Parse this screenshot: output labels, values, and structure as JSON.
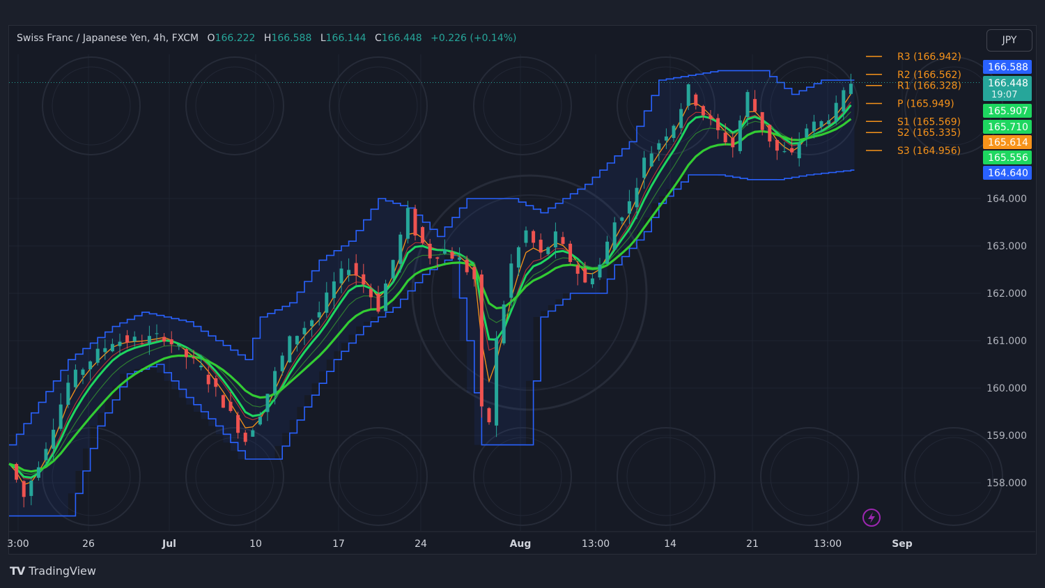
{
  "header": {
    "symbol": "Swiss Franc / Japanese Yen, 4h, FXCM",
    "open_label": "O",
    "open": "166.222",
    "high_label": "H",
    "high": "166.588",
    "low_label": "L",
    "low": "166.144",
    "close_label": "C",
    "close": "166.448",
    "change": "+0.226 (+0.14%)"
  },
  "currency_button": "JPY",
  "brand": {
    "name": "TradingView"
  },
  "colors": {
    "background": "#161a25",
    "up": "#26a69a",
    "down": "#ef5350",
    "channel": "#2962ff",
    "ema_fast": "#1ed760",
    "ema_slow": "#33cc33",
    "orange": "#f7931a",
    "red_line": "#e53935"
  },
  "chart_data": {
    "type": "candlestick",
    "timeframe": "4h",
    "y_ticks": [
      "164.000",
      "163.000",
      "162.000",
      "161.000",
      "160.000",
      "159.000",
      "158.000"
    ],
    "x_ticks": [
      {
        "label": "3:00",
        "bold": false
      },
      {
        "label": "26",
        "bold": false
      },
      {
        "label": "Jul",
        "bold": true
      },
      {
        "label": "10",
        "bold": false
      },
      {
        "label": "17",
        "bold": false
      },
      {
        "label": "24",
        "bold": false
      },
      {
        "label": "Aug",
        "bold": true
      },
      {
        "label": "13:00",
        "bold": false
      },
      {
        "label": "14",
        "bold": false
      },
      {
        "label": "21",
        "bold": false
      },
      {
        "label": "13:00",
        "bold": false
      },
      {
        "label": "Sep",
        "bold": true
      }
    ],
    "price_path": [
      [
        0,
        158.4
      ],
      [
        2,
        157.7
      ],
      [
        5,
        158.8
      ],
      [
        8,
        160.1
      ],
      [
        11,
        160.6
      ],
      [
        14,
        161.0
      ],
      [
        18,
        161.0
      ],
      [
        21,
        161.1
      ],
      [
        23,
        160.8
      ],
      [
        26,
        160.4
      ],
      [
        29,
        159.7
      ],
      [
        32,
        158.9
      ],
      [
        34,
        159.5
      ],
      [
        36,
        160.3
      ],
      [
        38,
        161.0
      ],
      [
        40,
        161.3
      ],
      [
        42,
        161.6
      ],
      [
        44,
        162.2
      ],
      [
        46,
        162.6
      ],
      [
        48,
        162.2
      ],
      [
        50,
        161.7
      ],
      [
        52,
        162.7
      ],
      [
        54,
        163.7
      ],
      [
        55,
        163.3
      ],
      [
        57,
        162.8
      ],
      [
        59,
        162.9
      ],
      [
        61,
        162.7
      ],
      [
        63,
        162.3
      ],
      [
        64,
        159.5
      ],
      [
        65,
        159.3
      ],
      [
        66,
        161.0
      ],
      [
        68,
        162.6
      ],
      [
        70,
        163.3
      ],
      [
        72,
        162.8
      ],
      [
        74,
        163.2
      ],
      [
        76,
        162.7
      ],
      [
        78,
        162.2
      ],
      [
        80,
        162.6
      ],
      [
        82,
        163.5
      ],
      [
        84,
        163.9
      ],
      [
        86,
        164.8
      ],
      [
        88,
        165.2
      ],
      [
        90,
        165.6
      ],
      [
        92,
        166.3
      ],
      [
        94,
        165.8
      ],
      [
        96,
        165.4
      ],
      [
        98,
        165.1
      ],
      [
        100,
        166.2
      ],
      [
        102,
        165.5
      ],
      [
        104,
        165.0
      ],
      [
        106,
        164.9
      ],
      [
        108,
        165.5
      ],
      [
        110,
        165.6
      ],
      [
        112,
        165.9
      ],
      [
        114,
        166.45
      ]
    ],
    "donchian_upper": [
      [
        0,
        158.8
      ],
      [
        8,
        160.6
      ],
      [
        14,
        161.3
      ],
      [
        18,
        161.6
      ],
      [
        24,
        161.4
      ],
      [
        28,
        161.0
      ],
      [
        32,
        160.6
      ],
      [
        34,
        161.5
      ],
      [
        38,
        161.8
      ],
      [
        42,
        162.7
      ],
      [
        46,
        163.1
      ],
      [
        50,
        164.0
      ],
      [
        54,
        163.8
      ],
      [
        58,
        163.2
      ],
      [
        62,
        164.0
      ],
      [
        68,
        164.0
      ],
      [
        72,
        163.7
      ],
      [
        78,
        164.3
      ],
      [
        84,
        165.2
      ],
      [
        88,
        166.5
      ],
      [
        96,
        166.7
      ],
      [
        102,
        166.7
      ],
      [
        106,
        166.2
      ],
      [
        110,
        166.5
      ],
      [
        114,
        166.5
      ]
    ],
    "donchian_lower": [
      [
        0,
        157.3
      ],
      [
        8,
        157.3
      ],
      [
        12,
        159.2
      ],
      [
        16,
        160.3
      ],
      [
        20,
        160.5
      ],
      [
        24,
        159.8
      ],
      [
        28,
        159.2
      ],
      [
        32,
        158.5
      ],
      [
        36,
        158.5
      ],
      [
        40,
        159.6
      ],
      [
        44,
        160.6
      ],
      [
        48,
        161.3
      ],
      [
        52,
        161.7
      ],
      [
        56,
        162.4
      ],
      [
        60,
        162.8
      ],
      [
        62,
        161.0
      ],
      [
        64,
        158.8
      ],
      [
        70,
        158.8
      ],
      [
        72,
        161.5
      ],
      [
        76,
        162.0
      ],
      [
        80,
        162.0
      ],
      [
        82,
        162.6
      ],
      [
        86,
        163.3
      ],
      [
        88,
        163.9
      ],
      [
        92,
        164.5
      ],
      [
        96,
        164.5
      ],
      [
        100,
        164.4
      ],
      [
        104,
        164.4
      ],
      [
        108,
        164.5
      ],
      [
        114,
        164.6
      ]
    ],
    "pivots": [
      {
        "label": "R3 (166.942)",
        "value": 166.942
      },
      {
        "label": "R2 (166.562)",
        "value": 166.562
      },
      {
        "label": "R1 (166.328)",
        "value": 166.328
      },
      {
        "label": "P (165.949)",
        "value": 165.949
      },
      {
        "label": "S1 (165.569)",
        "value": 165.569
      },
      {
        "label": "S2 (165.335)",
        "value": 165.335
      },
      {
        "label": "S3 (164.956)",
        "value": 164.956
      }
    ],
    "price_badges": [
      {
        "text": "166.588",
        "value": 166.588,
        "color": "#2962ff"
      },
      {
        "text": "166.448",
        "sub": "19:07",
        "value": 166.448,
        "color": "#26a69a"
      },
      {
        "text": "165.907",
        "value": 165.907,
        "color": "#1ed760"
      },
      {
        "text": "165.710",
        "value": 165.71,
        "color": "#1ed760"
      },
      {
        "text": "165.614",
        "value": 165.614,
        "color": "#f7931a"
      },
      {
        "text": "165.556",
        "value": 165.556,
        "color": "#1ed760"
      },
      {
        "text": "164.640",
        "value": 164.64,
        "color": "#2962ff"
      }
    ],
    "grid": true
  }
}
